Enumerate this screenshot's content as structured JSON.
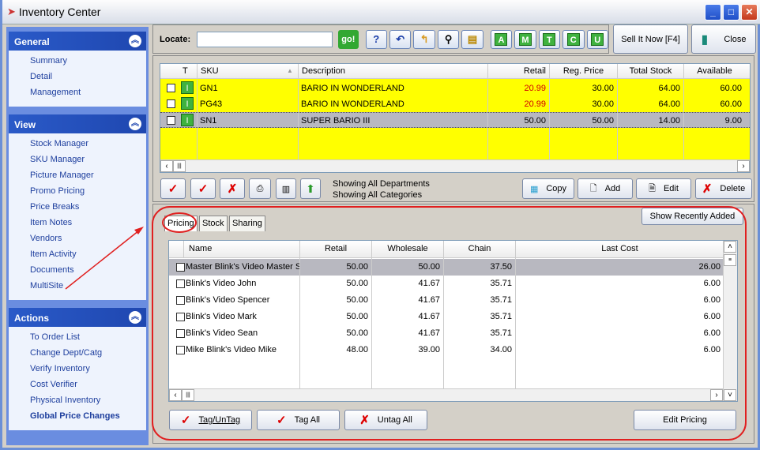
{
  "window": {
    "title": "Inventory Center"
  },
  "sidebar": {
    "general": {
      "title": "General",
      "items": [
        "Summary",
        "Detail",
        "Management"
      ]
    },
    "view": {
      "title": "View",
      "items": [
        "Stock Manager",
        "SKU Manager",
        "Picture Manager",
        "Promo Pricing",
        "Price Breaks",
        "Item Notes",
        "Vendors",
        "Item Activity",
        "Documents",
        "MultiSite"
      ]
    },
    "actions": {
      "title": "Actions",
      "items": [
        "To Order List",
        "Change Dept/Catg",
        "Verify Inventory",
        "Cost Verifier",
        "Physical Inventory",
        "Global Price Changes"
      ]
    }
  },
  "toolbar": {
    "locate_label": "Locate:",
    "locate_value": "",
    "go": "go!",
    "filters": [
      "A",
      "M",
      "T",
      "C",
      "U"
    ],
    "sell_now": "Sell It Now [F4]",
    "close": "Close"
  },
  "grid": {
    "columns": [
      "T",
      "SKU",
      "Description",
      "Retail",
      "Reg. Price",
      "Total Stock",
      "Available"
    ],
    "rows": [
      {
        "sku": "GN1",
        "description": "BARIO IN WONDERLAND",
        "retail": "20.99",
        "reg_price": "30.00",
        "total_stock": "64.00",
        "available": "60.00",
        "type": "I"
      },
      {
        "sku": "PG43",
        "description": "BARIO IN WONDERLAND",
        "retail": "20.99",
        "reg_price": "30.00",
        "total_stock": "64.00",
        "available": "60.00",
        "type": "I"
      },
      {
        "sku": "SN1",
        "description": "SUPER BARIO III",
        "retail": "50.00",
        "reg_price": "50.00",
        "total_stock": "14.00",
        "available": "9.00",
        "type": "I"
      }
    ],
    "status_line1": "Showing All Departments",
    "status_line2": "Showing All Categories",
    "copy": "Copy",
    "add": "Add",
    "edit": "Edit",
    "delete": "Delete",
    "highlight_color": "#ffff00",
    "sale_price_color": "#d00000"
  },
  "lower": {
    "tabs": [
      "Pricing",
      "Stock",
      "Sharing"
    ],
    "active_tab": "Pricing",
    "show_recent": "Show Recently Added",
    "columns": [
      "Name",
      "Retail",
      "Wholesale",
      "Chain",
      "Last Cost"
    ],
    "rows": [
      {
        "name": "Master Blink's Video Master Si",
        "retail": "50.00",
        "wholesale": "50.00",
        "chain": "37.50",
        "last_cost": "26.00"
      },
      {
        "name": "Blink's Video John",
        "retail": "50.00",
        "wholesale": "41.67",
        "chain": "35.71",
        "last_cost": "6.00"
      },
      {
        "name": "Blink's Video Spencer",
        "retail": "50.00",
        "wholesale": "41.67",
        "chain": "35.71",
        "last_cost": "6.00"
      },
      {
        "name": "Blink's Video Mark",
        "retail": "50.00",
        "wholesale": "41.67",
        "chain": "35.71",
        "last_cost": "6.00"
      },
      {
        "name": "Blink's Video Sean",
        "retail": "50.00",
        "wholesale": "41.67",
        "chain": "35.71",
        "last_cost": "6.00"
      },
      {
        "name": "Mike Blink's Video Mike",
        "retail": "48.00",
        "wholesale": "39.00",
        "chain": "34.00",
        "last_cost": "6.00"
      }
    ],
    "tag_untag": "Tag/UnTag",
    "tag_all": "Tag All",
    "untag_all": "Untag All",
    "edit_pricing": "Edit Pricing"
  },
  "annotation_color": "#e02020"
}
